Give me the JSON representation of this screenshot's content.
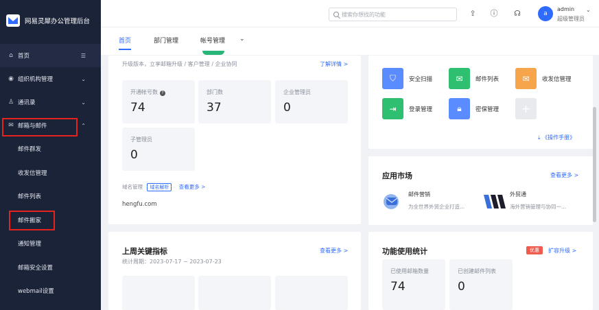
{
  "sidebar": {
    "brand_title": "网易灵犀办公管理后台",
    "items": [
      {
        "label": "首页",
        "icon": "home-icon"
      },
      {
        "label": "组织机构管理",
        "icon": "org-icon"
      },
      {
        "label": "通讯录",
        "icon": "contacts-icon"
      },
      {
        "label": "邮箱与邮件",
        "icon": "mail-icon"
      }
    ],
    "sub_items": [
      "邮件群发",
      "收发信管理",
      "邮件列表",
      "邮件搬家",
      "通知管理",
      "邮箱安全设置",
      "webmail设置"
    ]
  },
  "topbar": {
    "search_placeholder": "搜索你想找的功能",
    "avatar_letter": "a",
    "user_name": "admin",
    "user_role": "超级管理员"
  },
  "tabs": [
    "首页",
    "部门管理",
    "帐号管理"
  ],
  "overview": {
    "upgrade_text": "升级版本，立享邮箱升级 / 客户管理 / 企业协同",
    "learn_more": "了解详情 >",
    "stats": [
      {
        "label": "开通帐号数",
        "value": "74"
      },
      {
        "label": "部门数",
        "value": "37"
      },
      {
        "label": "企业管理员",
        "value": "0"
      },
      {
        "label": "子管理员",
        "value": "0"
      }
    ],
    "domain_label": "域名管理",
    "domain_tag": "域名解析",
    "domain_more": "查看更多 >",
    "domain": "hengfu.com"
  },
  "tools": {
    "items": [
      {
        "label": "安全扫描",
        "icon": "shield-icon",
        "color": "#5b8cff"
      },
      {
        "label": "邮件列表",
        "icon": "mail-list-icon",
        "color": "#2fbf71"
      },
      {
        "label": "收发信管理",
        "icon": "mail-manage-icon",
        "color": "#f7a54a"
      },
      {
        "label": "登录管理",
        "icon": "login-icon",
        "color": "#2fbf71"
      },
      {
        "label": "密保管理",
        "icon": "lock-icon",
        "color": "#5b8cff"
      }
    ],
    "manual": "《操作手册》"
  },
  "market": {
    "title": "应用市场",
    "more": "查看更多 >",
    "apps": [
      {
        "name": "邮件营销",
        "desc": "为全世界外贸企业打造..."
      },
      {
        "name": "外贸通",
        "desc": "海外营销管理与协同一..."
      }
    ]
  },
  "weekly": {
    "title": "上周关键指标",
    "more": "查看更多 >",
    "period": "统计周期：2023-07-17 ~ 2023-07-23"
  },
  "usage": {
    "title": "功能使用统计",
    "badge": "优惠",
    "upgrade": "扩容升级 >",
    "labels": [
      "已使用邮箱数量",
      "已创建邮件列表"
    ],
    "values": [
      "74",
      "0"
    ]
  }
}
